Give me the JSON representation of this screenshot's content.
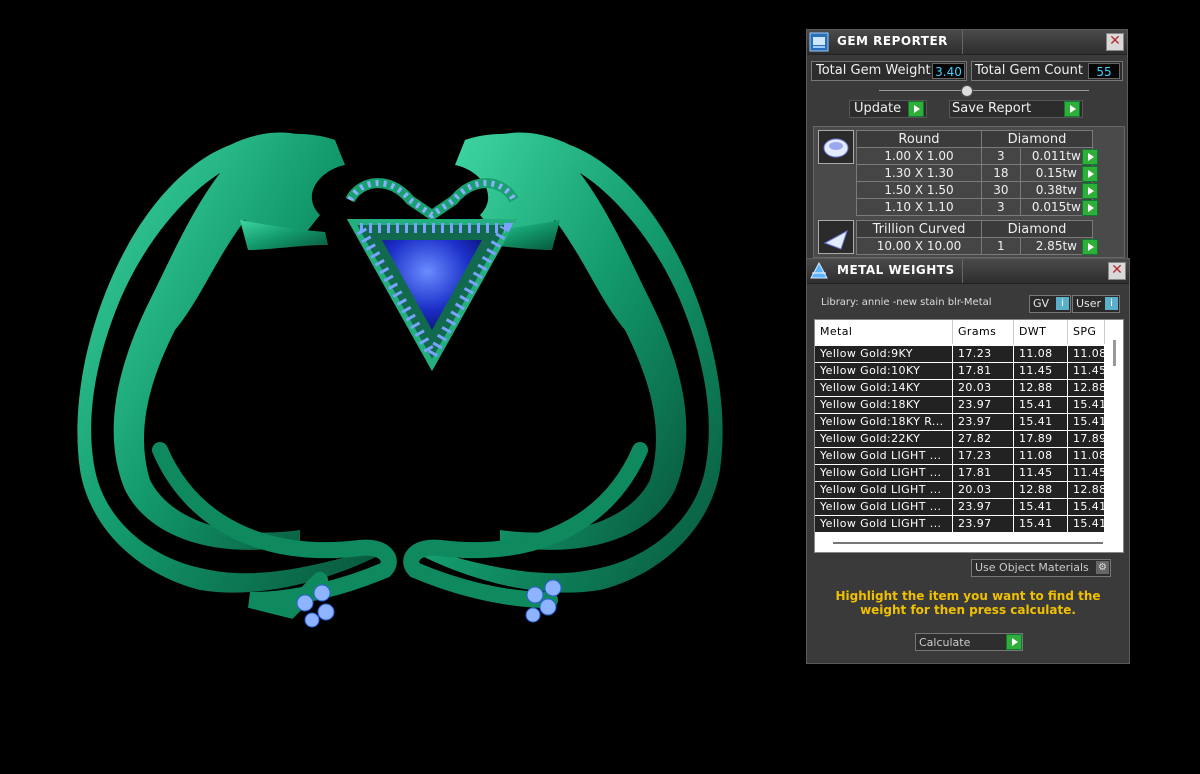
{
  "gem_reporter": {
    "title": "GEM REPORTER",
    "total_weight_label": "Total Gem Weight",
    "total_weight_value": "3.40",
    "total_count_label": "Total Gem Count",
    "total_count_value": "55",
    "update_label": "Update",
    "save_label": "Save Report",
    "groups": [
      {
        "shape": "Round",
        "material": "Diamond",
        "rows": [
          {
            "size": "1.00 X 1.00",
            "count": "3",
            "weight": "0.011tw"
          },
          {
            "size": "1.30 X 1.30",
            "count": "18",
            "weight": "0.15tw"
          },
          {
            "size": "1.50 X 1.50",
            "count": "30",
            "weight": "0.38tw"
          },
          {
            "size": "1.10 X 1.10",
            "count": "3",
            "weight": "0.015tw"
          }
        ]
      },
      {
        "shape": "Trillion Curved",
        "material": "Diamond",
        "rows": [
          {
            "size": "10.00 X 10.00",
            "count": "1",
            "weight": "2.85tw"
          }
        ]
      }
    ]
  },
  "metal_weights": {
    "title": "METAL WEIGHTS",
    "library": "Library: annie -new stain blr-Metal",
    "gv_label": "GV",
    "user_label": "User",
    "columns": [
      "Metal",
      "Grams",
      "DWT",
      "SPG"
    ],
    "rows": [
      [
        "Yellow Gold:9KY",
        "17.23",
        "11.08",
        "11.08"
      ],
      [
        "Yellow Gold:10KY",
        "17.81",
        "11.45",
        "11.45"
      ],
      [
        "Yellow Gold:14KY",
        "20.03",
        "12.88",
        "12.88"
      ],
      [
        "Yellow Gold:18KY",
        "23.97",
        "15.41",
        "15.41"
      ],
      [
        "Yellow Gold:18KY R...",
        "23.97",
        "15.41",
        "15.41"
      ],
      [
        "Yellow Gold:22KY",
        "27.82",
        "17.89",
        "17.89"
      ],
      [
        "Yellow Gold LIGHT ...",
        "17.23",
        "11.08",
        "11.08"
      ],
      [
        "Yellow Gold LIGHT ...",
        "17.81",
        "11.45",
        "11.45"
      ],
      [
        "Yellow Gold LIGHT ...",
        "20.03",
        "12.88",
        "12.88"
      ],
      [
        "Yellow Gold LIGHT ...",
        "23.97",
        "15.41",
        "15.41"
      ],
      [
        "Yellow Gold LIGHT ...",
        "23.97",
        "15.41",
        "15.41"
      ]
    ],
    "use_object_label": "Use Object Materials",
    "instruction": "Highlight the item you want to find the weight for then press calculate.",
    "calculate_label": "Calculate"
  },
  "colors": {
    "accent_green": "#2fae3a",
    "value_cyan": "#3fd0ff",
    "instruction_yellow": "#f0c000"
  }
}
